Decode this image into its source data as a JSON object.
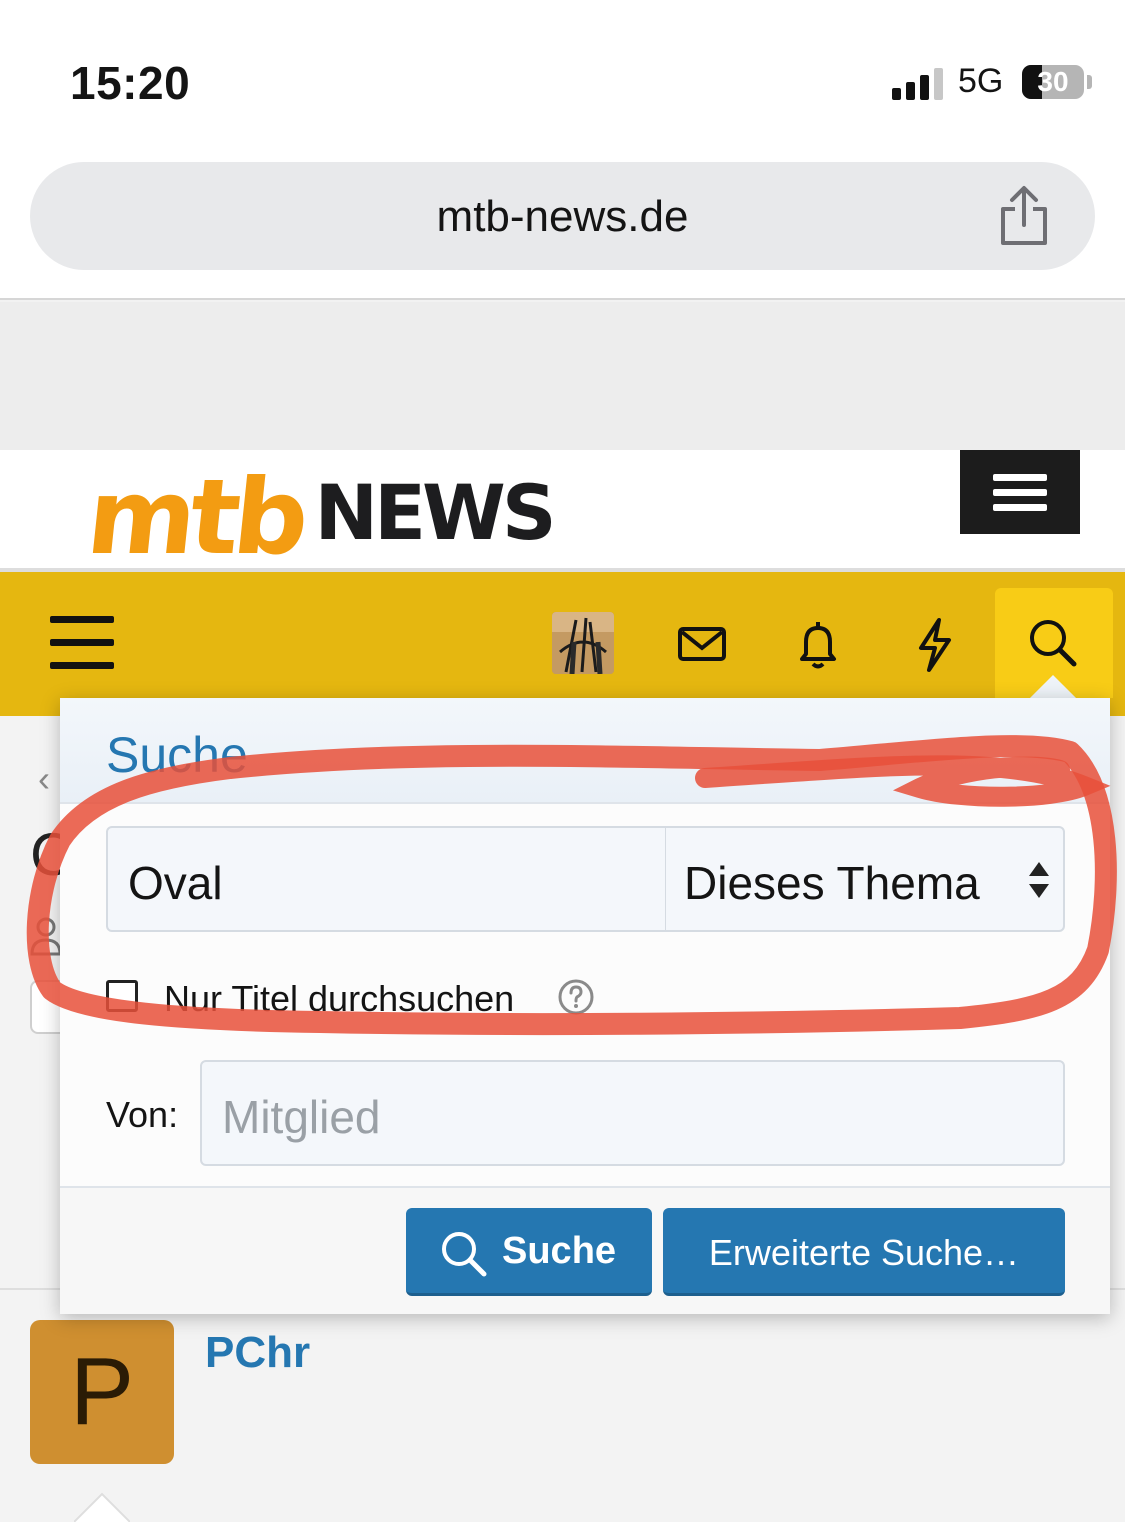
{
  "status_bar": {
    "time": "15:20",
    "network": "5G",
    "battery": "30"
  },
  "browser": {
    "url": "mtb-news.de"
  },
  "site": {
    "logo_mtb": "mtb",
    "logo_news": "NEWS"
  },
  "background": {
    "partial_letter": "C",
    "post_author": "PChr",
    "post_avatar_letter": "P"
  },
  "search_menu": {
    "title": "Suche",
    "keyword_value": "Oval",
    "scope_selected": "Dieses Thema",
    "title_only_label": "Nur Titel durchsuchen",
    "title_only_checked": false,
    "from_label": "Von:",
    "member_placeholder": "Mitglied",
    "search_button": "Suche",
    "advanced_button": "Erweiterte Suche…"
  },
  "colors": {
    "brand_orange": "#f39c12",
    "nav_yellow": "#e5b710",
    "link_blue": "#2577b1",
    "annotation_red": "#e8503a"
  }
}
